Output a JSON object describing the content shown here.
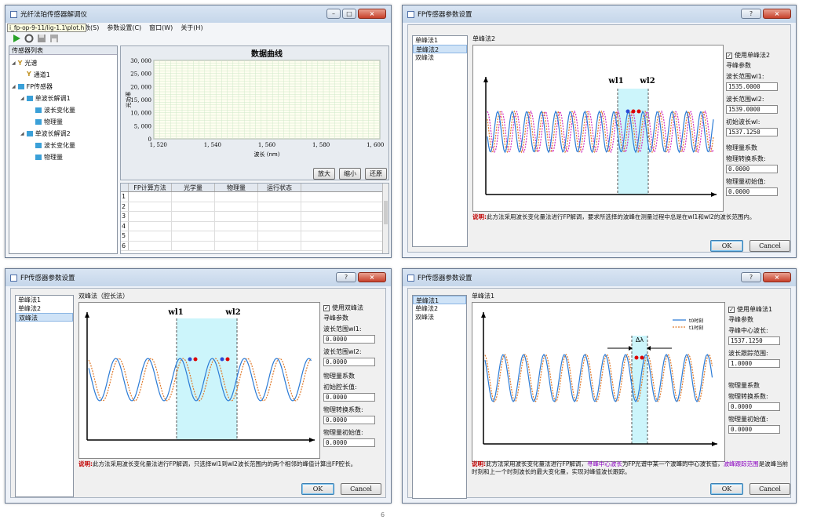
{
  "main": {
    "title": "光纤法珀传感器解调仪",
    "path": "i_fp-op-9-11/lig-1.1\\plot.h",
    "menus": [
      "参数设置(C)",
      "窗口(W)",
      "关于(H)"
    ],
    "menu_partial": "数(S)",
    "tree_header": "传感器列表",
    "tree": [
      "光谱",
      "通道1",
      "FP传感器",
      "单波长解调1",
      "波长变化量",
      "物理量",
      "单波长解调2",
      "波长变化量",
      "物理量"
    ],
    "chart_title": "数据曲线",
    "xlabel": "波长 (nm)",
    "ylabel": "光功率",
    "buttons": [
      "放大",
      "缩小",
      "还原"
    ],
    "table_headers": [
      "FP计算方法",
      "光学量",
      "物理量",
      "运行状态"
    ],
    "row_numbers": [
      "1",
      "2",
      "3",
      "4",
      "5",
      "6"
    ]
  },
  "chart_data": {
    "type": "line",
    "title": "数据曲线",
    "xlabel": "波长 (nm)",
    "ylabel": "光功率",
    "x_ticks": [
      "1, 520",
      "1, 540",
      "1, 560",
      "1, 580",
      "1, 600"
    ],
    "y_ticks": [
      "30, 000",
      "25, 000",
      "20, 000",
      "15, 000",
      "10, 000",
      "5, 000",
      "0"
    ],
    "xlim": [
      1520,
      1600
    ],
    "ylim": [
      0,
      30000
    ],
    "grid": true,
    "series": []
  },
  "dlg_tr": {
    "title": "FP传感器参数设置",
    "methods": [
      "单峰法1",
      "单峰法2",
      "双峰法"
    ],
    "group_title": "单峰法2",
    "diagram_labels": [
      "wl1",
      "wl2"
    ],
    "use_label": "使用单峰法2",
    "sec1": "寻峰参数",
    "f1_label": "波长范围wl1:",
    "f1_value": "1535.0000",
    "f2_label": "波长范围wl2:",
    "f2_value": "1539.0000",
    "f3_label": "初始波长wl:",
    "f3_value": "1537.1250",
    "sec2": "物理量系数",
    "f4_label": "物理转换系数:",
    "f4_value": "0.0000",
    "f5_label": "物理量初始值:",
    "f5_value": "0.0000",
    "note_key": "说明:",
    "note": "此方法采用波长变化量法进行FP解调，要求所选择的波峰在测量过程中总是在wl1和wl2的波长范围内。",
    "ok": "OK",
    "cancel": "Cancel"
  },
  "dlg_bl": {
    "title": "FP传感器参数设置",
    "methods": [
      "单峰法1",
      "单峰法2",
      "双峰法"
    ],
    "group_title": "双峰法（腔长法）",
    "diagram_labels": [
      "wl1",
      "wl2"
    ],
    "use_label": "使用双峰法",
    "sec1": "寻峰参数",
    "f1_label": "波长范围wl1:",
    "f1_value": "0.0000",
    "f2_label": "波长范围wl2:",
    "f2_value": "0.0000",
    "sec2": "物理量系数",
    "f3_label": "初始腔长值:",
    "f3_value": "0.0000",
    "f4_label": "物理转换系数:",
    "f4_value": "0.0000",
    "f5_label": "物理量初始值:",
    "f5_value": "0.0000",
    "note_key": "说明:",
    "note": "此方法采用波长变化量法进行FP解调，只选择wl1到wl2波长范围内的两个相邻的峰值计算出FP腔长。",
    "ok": "OK",
    "cancel": "Cancel"
  },
  "dlg_br": {
    "title": "FP传感器参数设置",
    "methods": [
      "单峰法1",
      "单峰法2",
      "双峰法"
    ],
    "group_title": "单峰法1",
    "legend": [
      "t0时刻",
      "t1时刻"
    ],
    "delta": "Δλ",
    "use_label": "使用单峰法1",
    "sec1": "寻峰参数",
    "f1_label": "寻峰中心波长:",
    "f1_value": "1537.1250",
    "f2_label": "波长跟踪范围:",
    "f2_value": "1.0000",
    "sec2": "物理量系数",
    "f4_label": "物理转换系数:",
    "f4_value": "0.0000",
    "f5_label": "物理量初始值:",
    "f5_value": "0.0000",
    "note_key": "说明:",
    "note_a": "此方法采用波长变化量法进行FP解调，",
    "note_b": "寻峰中心波长",
    "note_c": "为FP光谱中某一个波峰的中心波长值，",
    "note_d": "波峰跟踪范围",
    "note_e": "是波峰当前时刻和上一个时刻波长的最大变化量，实现对峰值波长跟踪。",
    "ok": "OK",
    "cancel": "Cancel"
  },
  "page_number": "6",
  "colors": {
    "highlight": "#ccf5fb",
    "blue": "#2b7bd6",
    "orange": "#e07a2a",
    "pink": "#d030c0",
    "accent": "#2255aa"
  }
}
